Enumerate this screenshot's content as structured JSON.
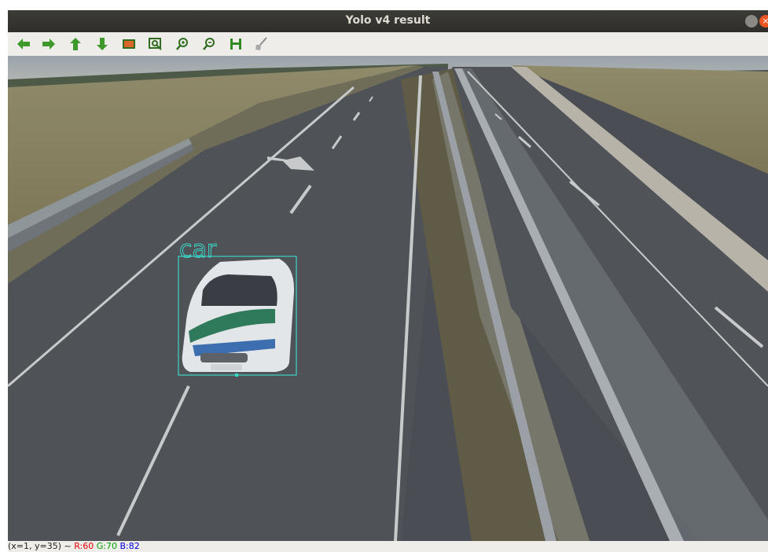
{
  "window": {
    "title": "Yolo v4 result"
  },
  "toolbar": {
    "buttons": [
      {
        "name": "pan-left",
        "icon": "arrow-left-icon"
      },
      {
        "name": "pan-right",
        "icon": "arrow-right-icon"
      },
      {
        "name": "pan-up",
        "icon": "arrow-up-icon"
      },
      {
        "name": "pan-down",
        "icon": "arrow-down-icon"
      },
      {
        "name": "zoom-fit",
        "icon": "image-icon"
      },
      {
        "name": "zoom-area",
        "icon": "zoom-rect-icon"
      },
      {
        "name": "zoom-in",
        "icon": "zoom-in-icon"
      },
      {
        "name": "zoom-out",
        "icon": "zoom-out-icon"
      },
      {
        "name": "save",
        "icon": "save-icon"
      },
      {
        "name": "properties",
        "icon": "brush-icon"
      }
    ]
  },
  "detection": {
    "label": "car",
    "color": "#3ad6c6"
  },
  "status": {
    "coords": "(x=1, y=35) ~ ",
    "r": "R:60",
    "g": "G:70",
    "b": "B:82",
    "r_color": "#e00000",
    "g_color": "#00a000",
    "b_color": "#0000e0"
  }
}
